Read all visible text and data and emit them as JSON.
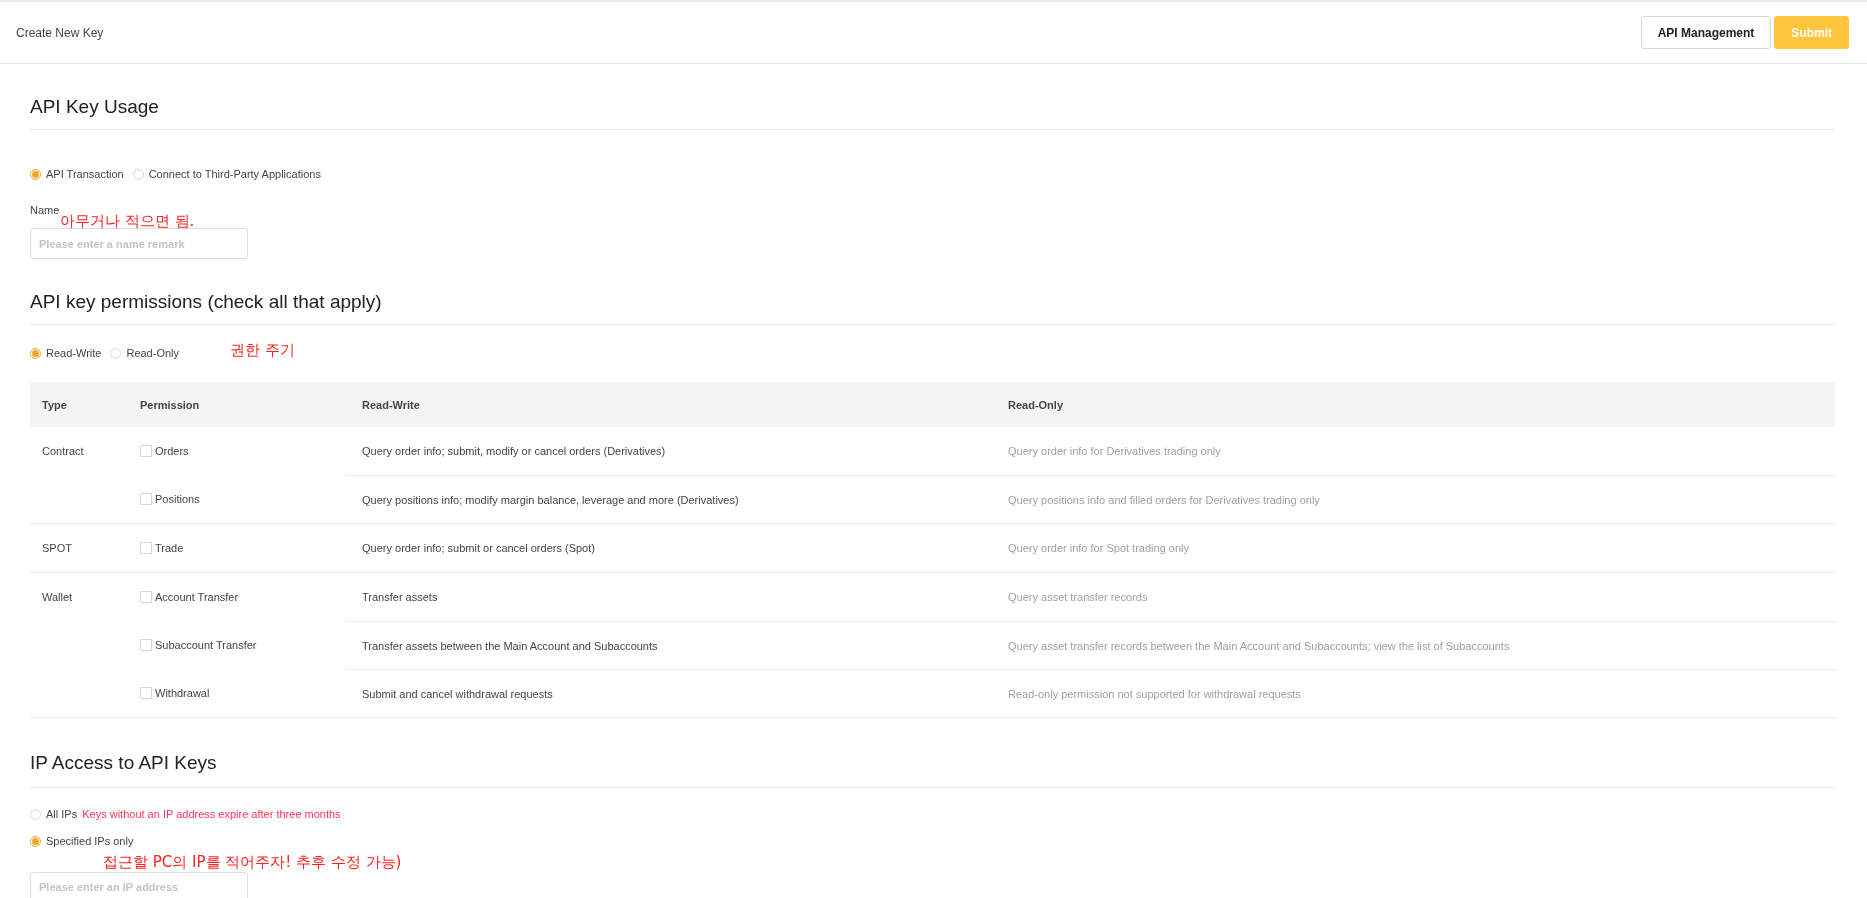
{
  "header": {
    "title": "Create New Key",
    "buttons": [
      {
        "label": "API Management",
        "kind": "outline"
      },
      {
        "label": "Submit",
        "kind": "primary"
      }
    ]
  },
  "usage": {
    "heading": "API Key Usage",
    "options": [
      {
        "label": "API Transaction",
        "selected": true
      },
      {
        "label": "Connect to Third-Party Applications",
        "selected": false
      }
    ],
    "name_field": {
      "label": "Name",
      "placeholder": "Please enter a name remark",
      "annotation": "아무거나 적으면 됨."
    }
  },
  "permissions": {
    "heading": "API key permissions (check all that apply)",
    "options": [
      {
        "label": "Read-Write",
        "selected": true
      },
      {
        "label": "Read-Only",
        "selected": false
      }
    ],
    "annotation": "권한 주기",
    "table": {
      "columns": [
        "Type",
        "Permission",
        "Read-Write",
        "Read-Only"
      ],
      "groups": [
        {
          "type": "Contract",
          "rows": [
            {
              "permission": "Orders",
              "checked": false,
              "read_write": "Query order info; submit, modify or cancel orders (Derivatives)",
              "read_only": "Query order info for Derivatives trading only"
            },
            {
              "permission": "Positions",
              "checked": false,
              "read_write": "Query positions info; modify margin balance, leverage and more (Derivatives)",
              "read_only": "Query positions info and filled orders for Derivatives trading only"
            }
          ]
        },
        {
          "type": "SPOT",
          "rows": [
            {
              "permission": "Trade",
              "checked": false,
              "read_write": "Query order info; submit or cancel orders (Spot)",
              "read_only": "Query order info for Spot trading only"
            }
          ]
        },
        {
          "type": "Wallet",
          "rows": [
            {
              "permission": "Account Transfer",
              "checked": false,
              "read_write": "Transfer assets",
              "read_only": "Query asset transfer records"
            },
            {
              "permission": "Subaccount Transfer",
              "checked": false,
              "read_write": "Transfer assets between the Main Account and Subaccounts",
              "read_only": "Query asset transfer records between the Main Account and Subaccounts; view the list of Subaccounts"
            },
            {
              "permission": "Withdrawal",
              "checked": false,
              "read_write": "Submit and cancel withdrawal requests",
              "read_only": "Read-only permission not supported for withdrawal requests"
            }
          ]
        }
      ]
    }
  },
  "ip_access": {
    "heading": "IP Access to API Keys",
    "options": [
      {
        "label": "All IPs",
        "selected": false,
        "note": "Keys without an IP address expire after three months"
      },
      {
        "label": "Specified IPs only",
        "selected": true
      }
    ],
    "ip_field": {
      "placeholder": "Please enter an IP address",
      "annotation": "접근할 PC의 IP를 적어주자! 추후 수정 가능)"
    }
  }
}
